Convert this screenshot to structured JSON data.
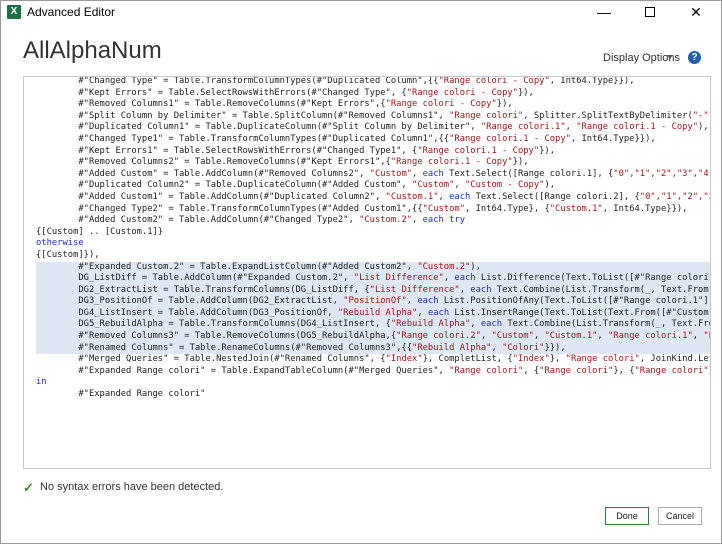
{
  "window": {
    "app_icon_letter": "X",
    "title": "Advanced Editor",
    "minimize_glyph": "—",
    "close_glyph": "✕"
  },
  "query_name": "AllAlphaNum",
  "toolbar": {
    "display_options_label": "Display Options",
    "help_glyph": "?"
  },
  "code_lines": [
    {
      "hl": false,
      "parts": [
        [
          "p",
          "        #\"Changed Type\" = Table.TransformColumnTypes(#\"Duplicated Column\",{{"
        ],
        [
          "s",
          "\"Range colori - Copy\""
        ],
        [
          "p",
          ", Int64.Type}}),"
        ]
      ]
    },
    {
      "hl": false,
      "parts": [
        [
          "p",
          "        #\"Kept Errors\" = Table.SelectRowsWithErrors(#\"Changed Type\", {"
        ],
        [
          "s",
          "\"Range colori - Copy\""
        ],
        [
          "p",
          "}),"
        ]
      ]
    },
    {
      "hl": false,
      "parts": [
        [
          "p",
          "        #\"Removed Columns1\" = Table.RemoveColumns(#\"Kept Errors\",{"
        ],
        [
          "s",
          "\"Range colori - Copy\""
        ],
        [
          "p",
          "}),"
        ]
      ]
    },
    {
      "hl": false,
      "parts": [
        [
          "p",
          "        #\"Split Column by Delimiter\" = Table.SplitColumn(#\"Removed Columns1\", "
        ],
        [
          "s",
          "\"Range colori\""
        ],
        [
          "p",
          ", Splitter.SplitTextByDelimiter("
        ],
        [
          "s",
          "\"-\""
        ],
        [
          "p",
          ", QuoteStyle.Csv),"
        ]
      ]
    },
    {
      "hl": false,
      "parts": [
        [
          "p",
          "        #\"Duplicated Column1\" = Table.DuplicateColumn(#\"Split Column by Delimiter\", "
        ],
        [
          "s",
          "\"Range colori.1\""
        ],
        [
          "p",
          ", "
        ],
        [
          "s",
          "\"Range colori.1 - Copy\""
        ],
        [
          "p",
          "),"
        ]
      ]
    },
    {
      "hl": false,
      "parts": [
        [
          "p",
          "        #\"Changed Type1\" = Table.TransformColumnTypes(#\"Duplicated Column1\",{{"
        ],
        [
          "s",
          "\"Range colori.1 - Copy\""
        ],
        [
          "p",
          ", Int64.Type}}),"
        ]
      ]
    },
    {
      "hl": false,
      "parts": [
        [
          "p",
          "        #\"Kept Errors1\" = Table.SelectRowsWithErrors(#\"Changed Type1\", {"
        ],
        [
          "s",
          "\"Range colori.1 - Copy\""
        ],
        [
          "p",
          "}),"
        ]
      ]
    },
    {
      "hl": false,
      "parts": [
        [
          "p",
          "        #\"Removed Columns2\" = Table.RemoveColumns(#\"Kept Errors1\",{"
        ],
        [
          "s",
          "\"Range colori.1 - Copy\""
        ],
        [
          "p",
          "}),"
        ]
      ]
    },
    {
      "hl": false,
      "parts": [
        [
          "p",
          "        #\"Added Custom\" = Table.AddColumn(#\"Removed Columns2\", "
        ],
        [
          "s",
          "\"Custom\""
        ],
        [
          "p",
          ", "
        ],
        [
          "k",
          "each"
        ],
        [
          "p",
          " Text.Select([Range colori.1], {"
        ],
        [
          "s",
          "\"0\",\"1\",\"2\",\"3\",\"4\",\"5\",\"6\",\"7\",\"8\","
        ]
      ]
    },
    {
      "hl": false,
      "parts": [
        [
          "p",
          "        #\"Duplicated Column2\" = Table.DuplicateColumn(#\"Added Custom\", "
        ],
        [
          "s",
          "\"Custom\""
        ],
        [
          "p",
          ", "
        ],
        [
          "s",
          "\"Custom - Copy\""
        ],
        [
          "p",
          "),"
        ]
      ]
    },
    {
      "hl": false,
      "parts": [
        [
          "p",
          "        #\"Added Custom1\" = Table.AddColumn(#\"Duplicated Column2\", "
        ],
        [
          "s",
          "\"Custom.1\""
        ],
        [
          "p",
          ", "
        ],
        [
          "k",
          "each"
        ],
        [
          "p",
          " Text.Select([Range colori.2], {"
        ],
        [
          "s",
          "\"0\",\"1\",\"2\",\"3\",\"4\",\"5\",\"6\",\"7\""
        ]
      ]
    },
    {
      "hl": false,
      "parts": [
        [
          "p",
          "        #\"Changed Type2\" = Table.TransformColumnTypes(#\"Added Custom1\",{{"
        ],
        [
          "s",
          "\"Custom\""
        ],
        [
          "p",
          ", Int64.Type}, {"
        ],
        [
          "s",
          "\"Custom.1\""
        ],
        [
          "p",
          ", Int64.Type}}),"
        ]
      ]
    },
    {
      "hl": false,
      "parts": [
        [
          "p",
          "        #\"Added Custom2\" = Table.AddColumn(#\"Changed Type2\", "
        ],
        [
          "s",
          "\"Custom.2\""
        ],
        [
          "p",
          ", "
        ],
        [
          "k",
          "each try"
        ]
      ]
    },
    {
      "hl": false,
      "parts": [
        [
          "p",
          "{[Custom] .. [Custom.1]}"
        ]
      ]
    },
    {
      "hl": false,
      "parts": [
        [
          "k",
          "otherwise"
        ]
      ]
    },
    {
      "hl": false,
      "parts": [
        [
          "p",
          "{[Custom]}),"
        ]
      ]
    },
    {
      "hl": true,
      "parts": [
        [
          "p",
          "        #\"Expanded Custom.2\" = Table.ExpandListColumn(#\"Added Custom2\", "
        ],
        [
          "s",
          "\"Custom.2\""
        ],
        [
          "p",
          "),"
        ]
      ]
    },
    {
      "hl": true,
      "parts": [
        [
          "p",
          "        DG_ListDiff = Table.AddColumn(#\"Expanded Custom.2\", "
        ],
        [
          "s",
          "\"List Difference\""
        ],
        [
          "p",
          ", "
        ],
        [
          "k",
          "each"
        ],
        [
          "p",
          " List.Difference(Text.ToList([#\"Range colori.1\"]),Text.ToList("
        ]
      ]
    },
    {
      "hl": true,
      "parts": [
        [
          "p",
          "        DG2_ExtractList = Table.TransformColumns(DG_ListDiff, {"
        ],
        [
          "s",
          "\"List Difference\""
        ],
        [
          "p",
          ", "
        ],
        [
          "k",
          "each"
        ],
        [
          "p",
          " Text.Combine(List.Transform(_, Text.From)), "
        ],
        [
          "k",
          "type text"
        ],
        [
          "p",
          "}),"
        ]
      ]
    },
    {
      "hl": true,
      "parts": [
        [
          "p",
          "        DG3_PositionOf = Table.AddColumn(DG2_ExtractList, "
        ],
        [
          "s",
          "\"PositionOf\""
        ],
        [
          "p",
          ", "
        ],
        [
          "k",
          "each"
        ],
        [
          "p",
          " List.PositionOfAny(Text.ToList([#\"Range colori.1\"]),Text.ToList([Lis"
        ]
      ]
    },
    {
      "hl": true,
      "parts": [
        [
          "p",
          "        DG4_ListInsert = Table.AddColumn(DG3_PositionOf, "
        ],
        [
          "s",
          "\"Rebuild Alpha\""
        ],
        [
          "p",
          ", "
        ],
        [
          "k",
          "each"
        ],
        [
          "p",
          " List.InsertRange(Text.ToList(Text.From([#\"Custom.2\"])),[PositionOf"
        ]
      ]
    },
    {
      "hl": true,
      "parts": [
        [
          "p",
          "        DG5_RebuildAlpha = Table.TransformColumns(DG4_ListInsert, {"
        ],
        [
          "s",
          "\"Rebuild Alpha\""
        ],
        [
          "p",
          ", "
        ],
        [
          "k",
          "each"
        ],
        [
          "p",
          " Text.Combine(List.Transform(_, Text.From)), "
        ],
        [
          "k",
          "type text"
        ],
        [
          "p",
          "}),"
        ]
      ]
    },
    {
      "hl": true,
      "parts": [
        [
          "p",
          "        #\"Removed Columns3\" = Table.RemoveColumns(DG5_RebuildAlpha,{"
        ],
        [
          "s",
          "\"Range colori.2\""
        ],
        [
          "p",
          ", "
        ],
        [
          "s",
          "\"Custom\""
        ],
        [
          "p",
          ", "
        ],
        [
          "s",
          "\"Custom.1\""
        ],
        [
          "p",
          ", "
        ],
        [
          "s",
          "\"Range colori.1\""
        ],
        [
          "p",
          ", "
        ],
        [
          "s",
          "\"List Difference\""
        ],
        [
          "p",
          ","
        ]
      ]
    },
    {
      "hl": true,
      "parts": [
        [
          "p",
          "        #\"Renamed Columns\" = Table.RenameColumns(#\"Removed Columns3\",{{"
        ],
        [
          "s",
          "\"Rebuild Alpha\""
        ],
        [
          "p",
          ", "
        ],
        [
          "s",
          "\"Colori\""
        ],
        [
          "p",
          "}}),"
        ]
      ]
    },
    {
      "hl": false,
      "parts": [
        [
          "p",
          "        #\"Merged Queries\" = Table.NestedJoin(#\"Renamed Columns\", {"
        ],
        [
          "s",
          "\"Index\""
        ],
        [
          "p",
          "}, CompletList, {"
        ],
        [
          "s",
          "\"Index\""
        ],
        [
          "p",
          "}, "
        ],
        [
          "s",
          "\"Range colori\""
        ],
        [
          "p",
          ", JoinKind.LeftOuter),"
        ]
      ]
    },
    {
      "hl": false,
      "parts": [
        [
          "p",
          "        #\"Expanded Range colori\" = Table.ExpandTableColumn(#\"Merged Queries\", "
        ],
        [
          "s",
          "\"Range colori\""
        ],
        [
          "p",
          ", {"
        ],
        [
          "s",
          "\"Range colori\""
        ],
        [
          "p",
          "}, {"
        ],
        [
          "s",
          "\"Range colori\""
        ],
        [
          "p",
          "})"
        ]
      ]
    },
    {
      "hl": false,
      "parts": [
        [
          "k",
          "in"
        ]
      ]
    },
    {
      "hl": false,
      "parts": [
        [
          "p",
          "        #\"Expanded Range colori\""
        ]
      ]
    }
  ],
  "status": {
    "icon": "check-icon",
    "glyph": "✓",
    "text": "No syntax errors have been detected."
  },
  "buttons": {
    "done_label": "Done",
    "cancel_label": "Cancel"
  },
  "colors": {
    "keyword": "#1f2ad8",
    "string": "#a3151a",
    "highlight": "#dfe7f2",
    "success": "#3c8a3c",
    "help": "#1e5fb4"
  }
}
